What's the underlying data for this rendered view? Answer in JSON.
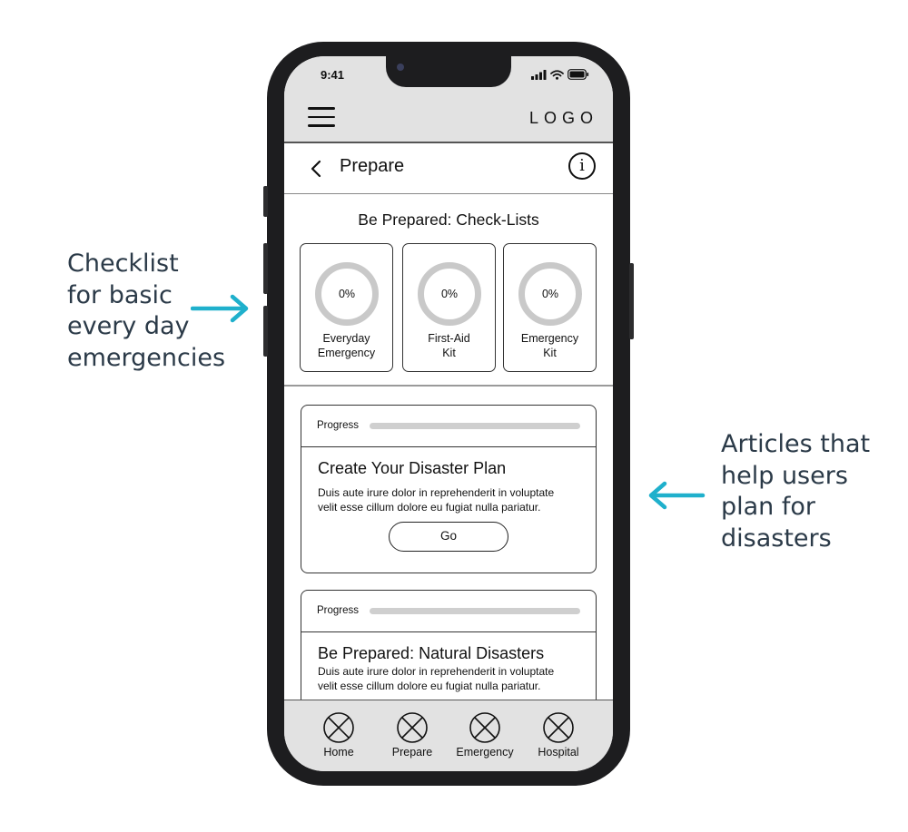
{
  "annotations": {
    "left": [
      "Checklist",
      "for basic",
      "every day",
      "emergencies"
    ],
    "right": [
      "Articles that",
      "help users",
      "plan for",
      "disasters"
    ],
    "accent_color": "#1fb0cc"
  },
  "status_bar": {
    "time": "9:41"
  },
  "header": {
    "logo": "LOGO",
    "menu_icon": "hamburger-icon"
  },
  "nav": {
    "title": "Prepare",
    "back_icon": "chevron-left-icon",
    "info_icon": "info-icon",
    "info_glyph": "i"
  },
  "checklists": {
    "title": "Be Prepared: Check-Lists",
    "items": [
      {
        "percent": "0%",
        "label_line1": "Everyday",
        "label_line2": "Emergency",
        "progress": 0
      },
      {
        "percent": "0%",
        "label_line1": "First-Aid",
        "label_line2": "Kit",
        "progress": 0
      },
      {
        "percent": "0%",
        "label_line1": "Emergency",
        "label_line2": "Kit",
        "progress": 0
      }
    ]
  },
  "articles": [
    {
      "progress_label": "Progress",
      "progress": 0,
      "title": "Create Your Disaster Plan",
      "body_line1": "Duis aute irure dolor in reprehenderit in voluptate",
      "body_line2": "velit esse cillum dolore eu fugiat nulla pariatur.",
      "button": "Go"
    },
    {
      "progress_label": "Progress",
      "progress": 0,
      "title": "Be Prepared: Natural Disasters",
      "body_line1": "Duis aute irure dolor in reprehenderit in voluptate",
      "body_line2": "velit esse cillum dolore eu fugiat nulla pariatur."
    }
  ],
  "tabbar": {
    "items": [
      {
        "label": "Home",
        "icon": "placeholder-icon"
      },
      {
        "label": "Prepare",
        "icon": "placeholder-icon"
      },
      {
        "label": "Emergency",
        "icon": "placeholder-icon"
      },
      {
        "label": "Hospital",
        "icon": "placeholder-icon"
      }
    ]
  }
}
